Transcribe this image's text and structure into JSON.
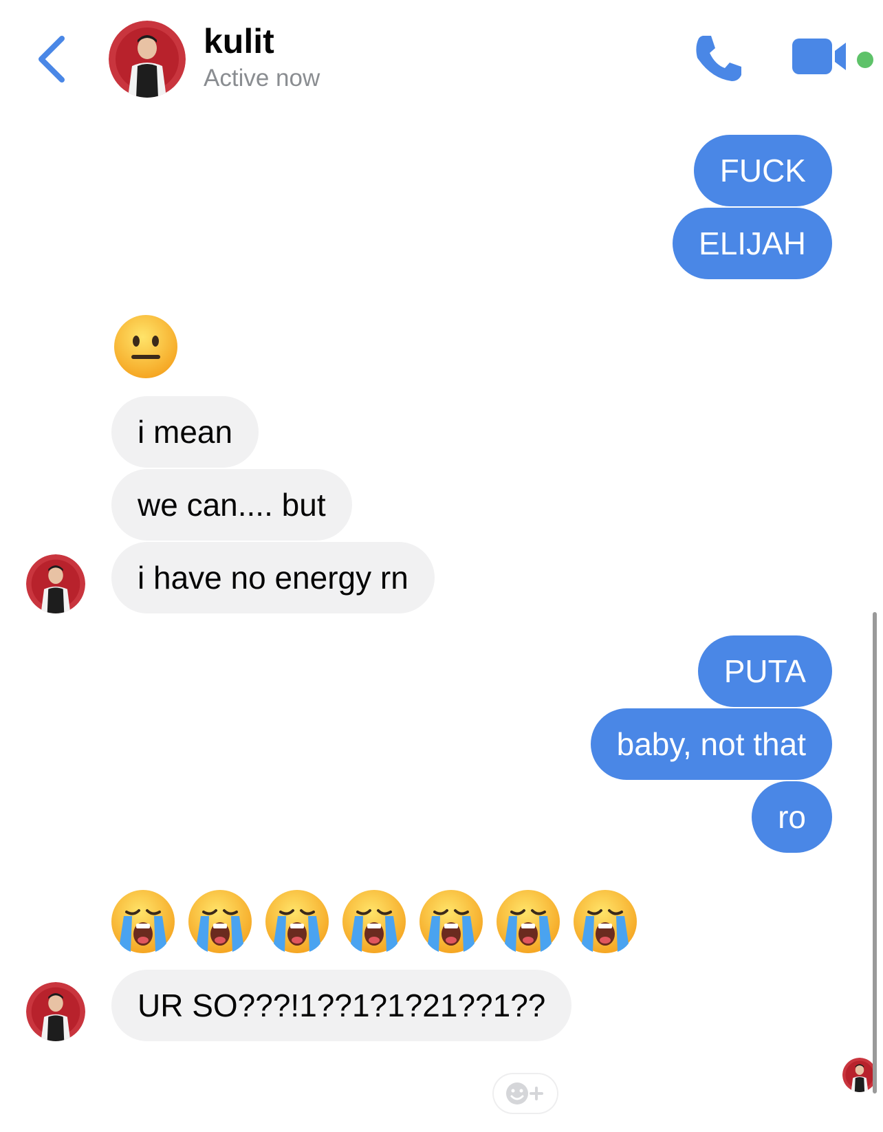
{
  "header": {
    "name": "kulit",
    "status": "Active now"
  },
  "colors": {
    "accent": "#4a87e6",
    "incoming_bubble": "#f1f1f2",
    "online": "#5ec269",
    "status_text": "#8a8d91"
  },
  "messages": {
    "out1": "FUCK",
    "out2": "ELIJAH",
    "in1": "i mean",
    "in2": "we can.... but",
    "in3": "i have no energy rn",
    "out3": "PUTA",
    "out4": "baby, not that",
    "out5": "ro",
    "in4": "UR SO???!1??1?1?21??1??"
  },
  "emoji": {
    "neutral": "neutral-face",
    "crying_count": 7,
    "crying": "loudly-crying-face"
  },
  "icons": {
    "back": "chevron-left-icon",
    "call": "phone-icon",
    "video": "video-camera-icon",
    "react": "add-reaction-icon"
  }
}
